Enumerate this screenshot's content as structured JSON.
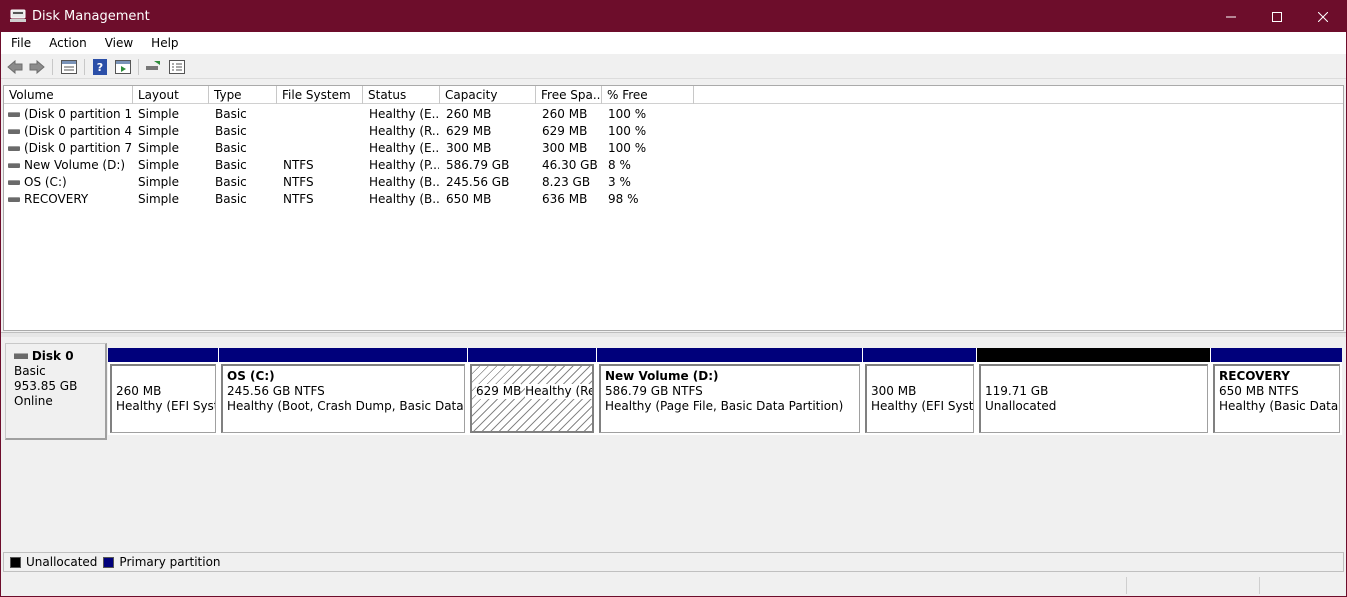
{
  "window": {
    "title": "Disk Management",
    "accent_color": "#6d0d2b"
  },
  "menu": {
    "items": [
      {
        "label": "File"
      },
      {
        "label": "Action"
      },
      {
        "label": "View"
      },
      {
        "label": "Help"
      }
    ]
  },
  "toolbar": {
    "icons": [
      "back-arrow-icon",
      "forward-arrow-icon",
      "properties-sheet-icon",
      "help-icon",
      "console-tree-icon",
      "rescan-disks-icon",
      "list-view-icon"
    ]
  },
  "volumes": {
    "columns": [
      "Volume",
      "Layout",
      "Type",
      "File System",
      "Status",
      "Capacity",
      "Free Spa...",
      "% Free"
    ],
    "rows": [
      {
        "volume": "(Disk 0 partition 1)",
        "layout": "Simple",
        "type": "Basic",
        "fs": "",
        "status": "Healthy (E...",
        "capacity": "260 MB",
        "free": "260 MB",
        "pct": "100 %"
      },
      {
        "volume": "(Disk 0 partition 4)",
        "layout": "Simple",
        "type": "Basic",
        "fs": "",
        "status": "Healthy (R...",
        "capacity": "629 MB",
        "free": "629 MB",
        "pct": "100 %"
      },
      {
        "volume": "(Disk 0 partition 7)",
        "layout": "Simple",
        "type": "Basic",
        "fs": "",
        "status": "Healthy (E...",
        "capacity": "300 MB",
        "free": "300 MB",
        "pct": "100 %"
      },
      {
        "volume": "New Volume (D:)",
        "layout": "Simple",
        "type": "Basic",
        "fs": "NTFS",
        "status": "Healthy (P...",
        "capacity": "586.79 GB",
        "free": "46.30 GB",
        "pct": "8 %"
      },
      {
        "volume": "OS (C:)",
        "layout": "Simple",
        "type": "Basic",
        "fs": "NTFS",
        "status": "Healthy (B...",
        "capacity": "245.56 GB",
        "free": "8.23 GB",
        "pct": "3 %"
      },
      {
        "volume": "RECOVERY",
        "layout": "Simple",
        "type": "Basic",
        "fs": "NTFS",
        "status": "Healthy (B...",
        "capacity": "650 MB",
        "free": "636 MB",
        "pct": "98 %"
      }
    ]
  },
  "disk0": {
    "name": "Disk 0",
    "kind": "Basic",
    "size": "953.85 GB",
    "state": "Online",
    "partitions": [
      {
        "name": "",
        "size": "260 MB",
        "status": "Healthy (EFI System Partition)",
        "bar_color": "#00007b"
      },
      {
        "name": "OS  (C:)",
        "size": "245.56 GB NTFS",
        "status": "Healthy (Boot, Crash Dump, Basic Data Partition)",
        "bar_color": "#00007b"
      },
      {
        "name": "",
        "size": "629 MB",
        "status": "Healthy (Recovery Partition)",
        "bar_color": "#00007b"
      },
      {
        "name": "New Volume  (D:)",
        "size": "586.79 GB NTFS",
        "status": "Healthy (Page File, Basic Data Partition)",
        "bar_color": "#00007b"
      },
      {
        "name": "",
        "size": "300 MB",
        "status": "Healthy (EFI System Partition)",
        "bar_color": "#00007b"
      },
      {
        "name": "",
        "size": "119.71 GB",
        "status": "Unallocated",
        "bar_color": "#000000"
      },
      {
        "name": "RECOVERY",
        "size": "650 MB NTFS",
        "status": "Healthy (Basic Data Partition)",
        "bar_color": "#00007b"
      }
    ]
  },
  "legend": {
    "unallocated": "Unallocated",
    "primary": "Primary partition",
    "unallocated_color": "#000000",
    "primary_color": "#00007b"
  }
}
